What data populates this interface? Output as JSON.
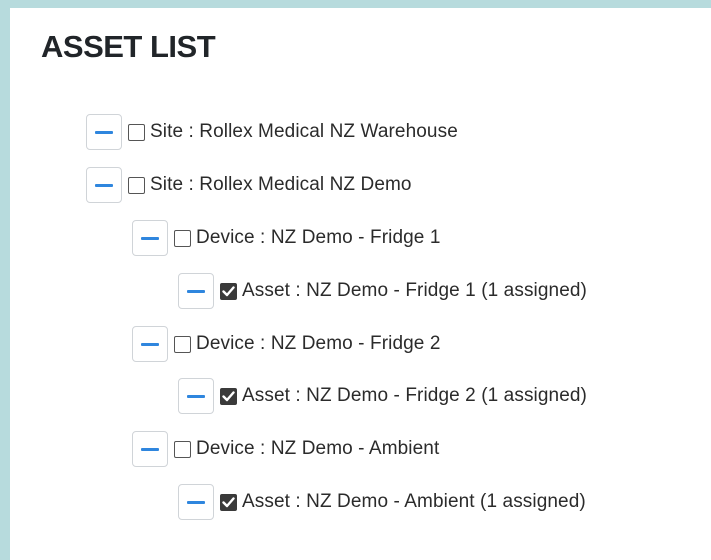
{
  "page": {
    "title": "ASSET LIST"
  },
  "tree": [
    {
      "type": "site",
      "label": "Site : Rollex Medical NZ Warehouse",
      "checked": false,
      "expanded": true
    },
    {
      "type": "site",
      "label": "Site : Rollex Medical NZ Demo",
      "checked": false,
      "expanded": true
    },
    {
      "type": "device",
      "label": "Device : NZ Demo - Fridge 1",
      "checked": false,
      "expanded": true
    },
    {
      "type": "asset",
      "label": "Asset : NZ Demo - Fridge 1 (1 assigned)",
      "checked": true,
      "expanded": true
    },
    {
      "type": "device",
      "label": "Device : NZ Demo - Fridge 2",
      "checked": false,
      "expanded": true
    },
    {
      "type": "asset",
      "label": "Asset : NZ Demo - Fridge 2 (1 assigned)",
      "checked": true,
      "expanded": true
    },
    {
      "type": "device",
      "label": "Device : NZ Demo - Ambient",
      "checked": false,
      "expanded": true
    },
    {
      "type": "asset",
      "label": "Asset : NZ Demo - Ambient (1 assigned)",
      "checked": true,
      "expanded": true
    }
  ],
  "icons": {
    "toggle": "collapse-minus-icon",
    "checkmark": "checkmark-icon"
  },
  "colors": {
    "page_background": "#b7dbdd",
    "panel_background": "#ffffff",
    "toggle_accent": "#2f86de",
    "text": "#2b2b2b",
    "checkbox_checked": "#3a3a3a"
  }
}
